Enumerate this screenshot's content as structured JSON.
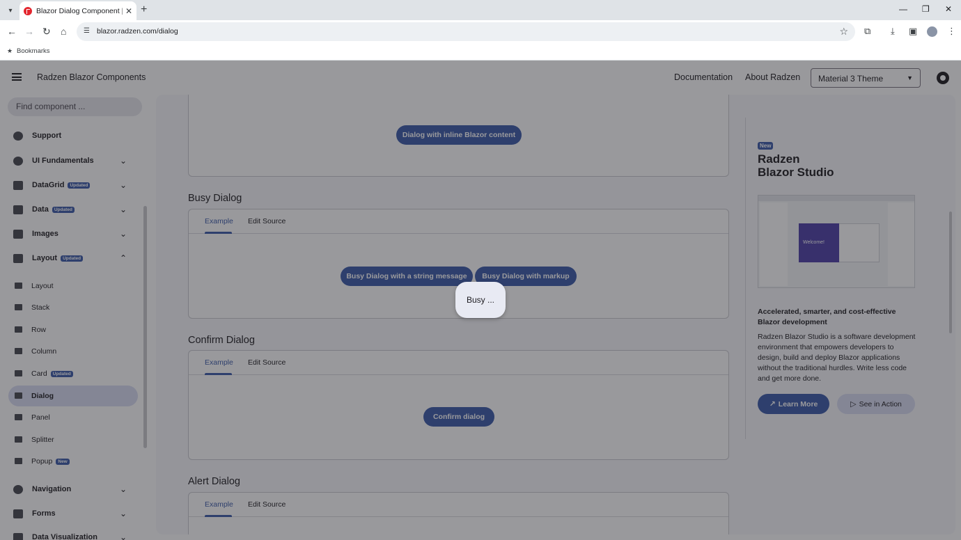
{
  "browser": {
    "tab_title": "Blazor Dialog Component | Free",
    "url": "blazor.radzen.com/dialog",
    "bookmarks_label": "Bookmarks",
    "new_tab": "+",
    "tab_close": "✕",
    "minimize": "—",
    "restore": "❐",
    "close": "✕"
  },
  "header": {
    "title": "Radzen Blazor Components",
    "links": [
      "Documentation",
      "About Radzen"
    ],
    "theme_select": "Material 3 Theme"
  },
  "sidebar": {
    "search_placeholder": "Find component ...",
    "items": [
      {
        "label": "Support",
        "icon": "help-icon"
      },
      {
        "label": "UI Fundamentals",
        "icon": "palette-icon"
      },
      {
        "label": "DataGrid",
        "icon": "grid-icon",
        "badge": "Updated"
      },
      {
        "label": "Data",
        "icon": "list-icon",
        "badge": "Updated"
      },
      {
        "label": "Images",
        "icon": "image-icon"
      },
      {
        "label": "Layout",
        "icon": "layout-icon",
        "badge": "Updated"
      }
    ],
    "sub_items": [
      {
        "label": "Layout"
      },
      {
        "label": "Stack"
      },
      {
        "label": "Row"
      },
      {
        "label": "Column"
      },
      {
        "label": "Card",
        "badge": "Updated"
      },
      {
        "label": "Dialog"
      },
      {
        "label": "Panel"
      },
      {
        "label": "Splitter"
      },
      {
        "label": "Popup",
        "badge": "New"
      }
    ],
    "bottom_items": [
      {
        "label": "Navigation"
      },
      {
        "label": "Forms"
      },
      {
        "label": "Data Visualization"
      }
    ]
  },
  "content": {
    "inline_button": "Dialog with inline Blazor content",
    "busy_title": "Busy Dialog",
    "confirm_title": "Confirm Dialog",
    "alert_title": "Alert Dialog",
    "tab_example": "Example",
    "tab_source": "Edit Source",
    "busy_btn_string": "Busy Dialog with a string message",
    "busy_btn_markup": "Busy Dialog with markup",
    "confirm_btn": "Confirm dialog"
  },
  "promo": {
    "badge": "New",
    "title": "Radzen\nBlazor Studio",
    "headline": "Accelerated, smarter, and cost-effective Blazor development",
    "body": "Radzen Blazor Studio is a software development environment that empowers developers to design, build and deploy Blazor applications without the traditional hurdles. Write less code and get more done.",
    "learn_more": "Learn More",
    "see_in_action": "See in Action",
    "screenshot_text": "Welcome!"
  },
  "dialog": {
    "message": "Busy ..."
  },
  "colors": {
    "primary": "#3a5aa8",
    "overlay": "#212128"
  }
}
